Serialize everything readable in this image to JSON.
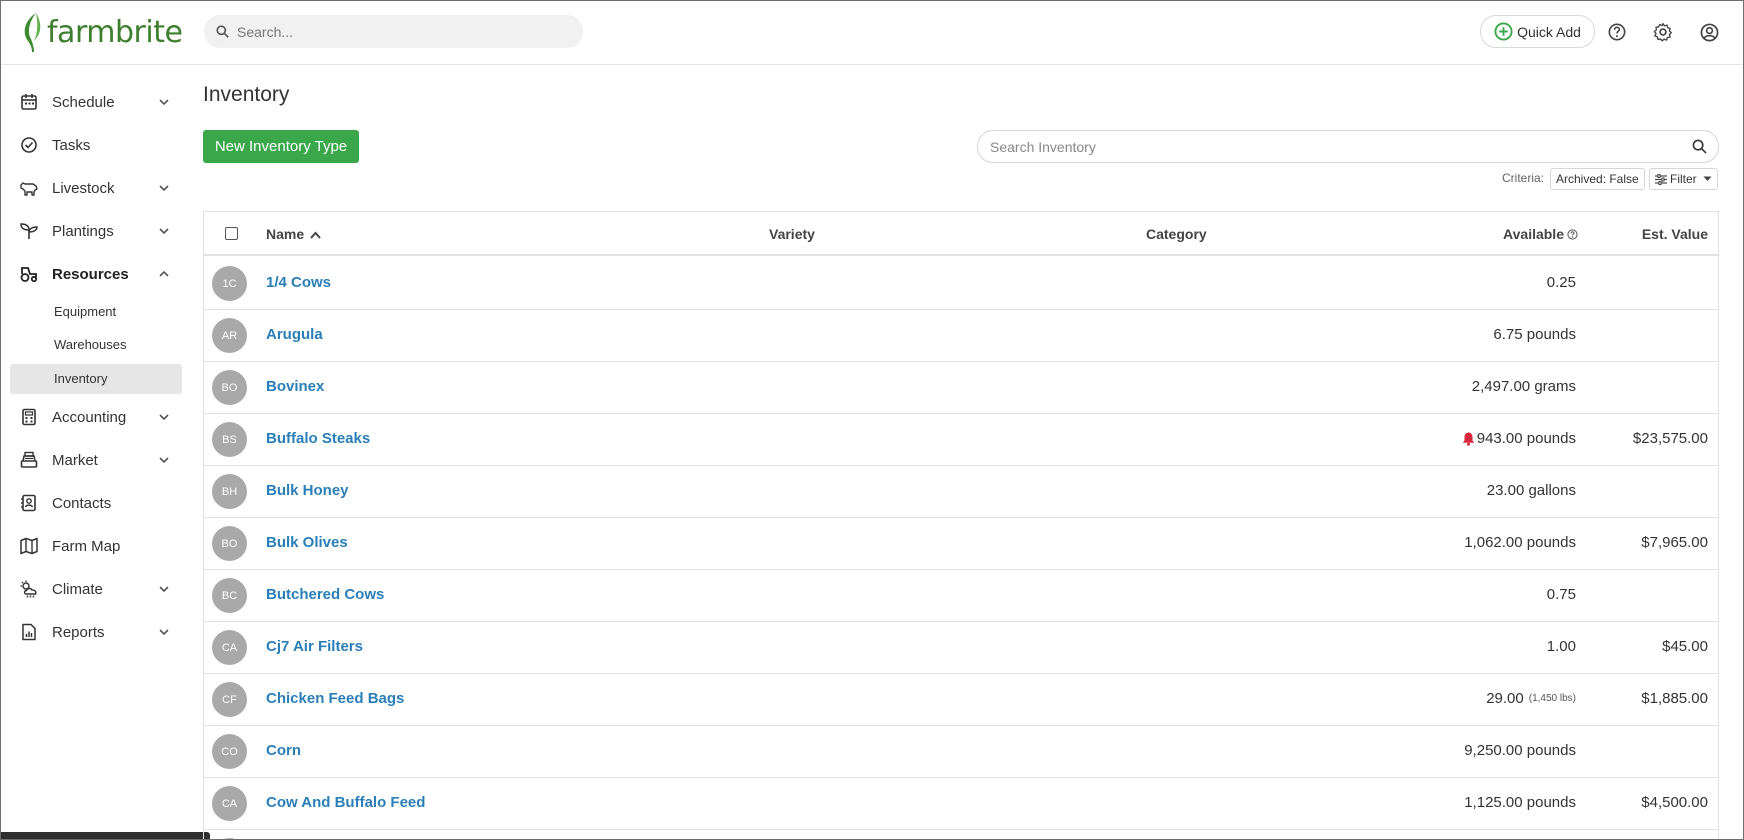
{
  "header": {
    "logo_text": "farmbrite",
    "search_placeholder": "Search...",
    "quick_add_label": "Quick Add",
    "icons": [
      "help-icon",
      "gear-icon",
      "user-icon"
    ],
    "brand_color": "#3d7e2f"
  },
  "sidebar": {
    "items": [
      {
        "label": "Schedule",
        "icon": "calendar-icon",
        "has_chevron": true
      },
      {
        "label": "Tasks",
        "icon": "check-circle-icon",
        "has_chevron": false
      },
      {
        "label": "Livestock",
        "icon": "cow-icon",
        "has_chevron": true
      },
      {
        "label": "Plantings",
        "icon": "sprout-icon",
        "has_chevron": true
      },
      {
        "label": "Resources",
        "icon": "tractor-icon",
        "has_chevron": true,
        "expanded": true
      },
      {
        "label": "Accounting",
        "icon": "calculator-icon",
        "has_chevron": true
      },
      {
        "label": "Market",
        "icon": "cash-register-icon",
        "has_chevron": true
      },
      {
        "label": "Contacts",
        "icon": "contacts-icon",
        "has_chevron": false
      },
      {
        "label": "Farm Map",
        "icon": "map-icon",
        "has_chevron": false
      },
      {
        "label": "Climate",
        "icon": "cloud-sun-icon",
        "has_chevron": true
      },
      {
        "label": "Reports",
        "icon": "report-icon",
        "has_chevron": true
      }
    ],
    "resources_sub": [
      {
        "label": "Equipment",
        "active": false
      },
      {
        "label": "Warehouses",
        "active": false
      },
      {
        "label": "Inventory",
        "active": true
      }
    ]
  },
  "main": {
    "title": "Inventory",
    "new_button_label": "New Inventory Type",
    "new_button_color": "#3aa84a",
    "search_placeholder": "Search Inventory",
    "criteria_label": "Criteria:",
    "criteria_chip": "Archived: False",
    "filter_label": "Filter"
  },
  "table": {
    "columns": {
      "name": "Name",
      "variety": "Variety",
      "category": "Category",
      "available": "Available",
      "est_value": "Est. Value"
    },
    "rows": [
      {
        "initials": "1C",
        "name": "1/4 Cows",
        "variety": "",
        "category": "",
        "available": "0.25",
        "note": "",
        "alert": false,
        "est_value": ""
      },
      {
        "initials": "AR",
        "name": "Arugula",
        "variety": "",
        "category": "",
        "available": "6.75 pounds",
        "note": "",
        "alert": false,
        "est_value": ""
      },
      {
        "initials": "BO",
        "name": "Bovinex",
        "variety": "",
        "category": "",
        "available": "2,497.00 grams",
        "note": "",
        "alert": false,
        "est_value": ""
      },
      {
        "initials": "BS",
        "name": "Buffalo Steaks",
        "variety": "",
        "category": "",
        "available": "943.00 pounds",
        "note": "",
        "alert": true,
        "est_value": "$23,575.00"
      },
      {
        "initials": "BH",
        "name": "Bulk Honey",
        "variety": "",
        "category": "",
        "available": "23.00 gallons",
        "note": "",
        "alert": false,
        "est_value": ""
      },
      {
        "initials": "BO",
        "name": "Bulk Olives",
        "variety": "",
        "category": "",
        "available": "1,062.00 pounds",
        "note": "",
        "alert": false,
        "est_value": "$7,965.00"
      },
      {
        "initials": "BC",
        "name": "Butchered Cows",
        "variety": "",
        "category": "",
        "available": "0.75",
        "note": "",
        "alert": false,
        "est_value": ""
      },
      {
        "initials": "CA",
        "name": "Cj7 Air Filters",
        "variety": "",
        "category": "",
        "available": "1.00",
        "note": "",
        "alert": false,
        "est_value": "$45.00"
      },
      {
        "initials": "CF",
        "name": "Chicken Feed Bags",
        "variety": "",
        "category": "",
        "available": "29.00",
        "note": "(1,450 lbs)",
        "alert": false,
        "est_value": "$1,885.00"
      },
      {
        "initials": "CO",
        "name": "Corn",
        "variety": "",
        "category": "",
        "available": "9,250.00 pounds",
        "note": "",
        "alert": false,
        "est_value": ""
      },
      {
        "initials": "CA",
        "name": "Cow And Buffalo Feed",
        "variety": "",
        "category": "",
        "available": "1,125.00 pounds",
        "note": "",
        "alert": false,
        "est_value": "$4,500.00"
      },
      {
        "initials": "",
        "name": "",
        "variety": "",
        "category": "",
        "available": "",
        "note": "",
        "alert": false,
        "est_value": ""
      }
    ]
  }
}
